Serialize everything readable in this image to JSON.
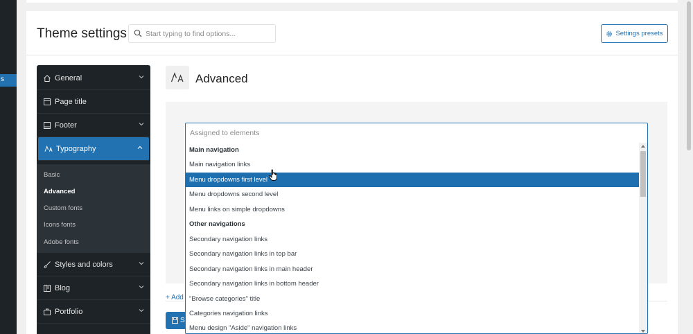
{
  "wp_menu": {
    "active_label": "s"
  },
  "header": {
    "title": "Theme settings",
    "search_placeholder": "Start typing to find options...",
    "presets_label": "Settings presets"
  },
  "sidebar": {
    "items": [
      {
        "label": "General",
        "icon": "home-icon",
        "expanded": false
      },
      {
        "label": "Page title",
        "icon": "page-title-icon",
        "expanded": false
      },
      {
        "label": "Footer",
        "icon": "footer-icon",
        "expanded": false
      },
      {
        "label": "Typography",
        "icon": "typography-icon",
        "expanded": true
      },
      {
        "label": "Styles and colors",
        "icon": "brush-icon",
        "expanded": false
      },
      {
        "label": "Blog",
        "icon": "blog-icon",
        "expanded": false
      },
      {
        "label": "Portfolio",
        "icon": "portfolio-icon",
        "expanded": false
      }
    ],
    "sub_items": [
      "Basic",
      "Advanced",
      "Custom fonts",
      "Icons fonts",
      "Adobe fonts"
    ],
    "current_sub": "Advanced"
  },
  "main": {
    "section_title": "Advanced",
    "add_link": "Add",
    "save_label": "S"
  },
  "dropdown": {
    "placeholder": "Assigned to elements",
    "options": [
      {
        "label": "Main navigation",
        "group": true
      },
      {
        "label": "Main navigation links"
      },
      {
        "label": "Menu dropdowns first level",
        "highlighted": true
      },
      {
        "label": "Menu dropdowns second level"
      },
      {
        "label": "Menu links on simple dropdowns"
      },
      {
        "label": "Other navigations",
        "group": true
      },
      {
        "label": "Secondary navigation links"
      },
      {
        "label": "Secondary navigation links in top bar"
      },
      {
        "label": "Secondary navigation links in main header"
      },
      {
        "label": "Secondary navigation links in bottom header"
      },
      {
        "label": "\"Browse categories\" title"
      },
      {
        "label": "Categories navigation links"
      },
      {
        "label": "Menu design \"Aside\" navigation links"
      }
    ]
  },
  "colors": {
    "accent": "#2271b1",
    "sidebar_bg": "#1d2327",
    "highlight": "#1e6fb0"
  }
}
